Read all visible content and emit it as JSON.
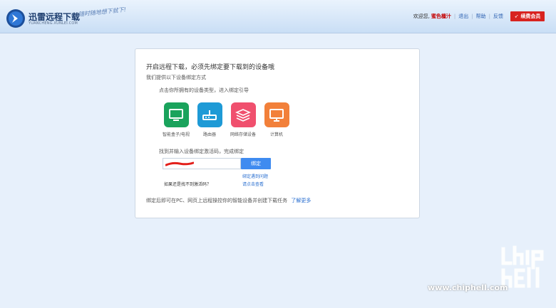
{
  "header": {
    "logo_title": "迅雷远程下载",
    "logo_sub": "YUANCHENG.XUNLEI.COM",
    "slogan": "随时随地想下就下!",
    "welcome": "欢迎您,",
    "username": "蜜色檀汁",
    "logout": "退出",
    "help": "帮助",
    "feedback": "反馈",
    "vip_button": "续费会员"
  },
  "panel": {
    "title": "开启远程下载，必须先绑定要下载到的设备哦",
    "subtitle": "我们提供以下设备绑定方式",
    "step1": "点击你所拥有的设备类型，进入绑定引导",
    "devices": [
      {
        "label": "智能盒子/电视",
        "color": "#1aa35c"
      },
      {
        "label": "路由器",
        "color": "#1e9ad6"
      },
      {
        "label": "网络存储设备",
        "color": "#f0506e"
      },
      {
        "label": "计算机",
        "color": "#f2803a"
      }
    ],
    "step2": "找到并输入设备绑定激活码，完成绑定",
    "bind_button": "绑定",
    "help_link_1": "绑定遇到问题",
    "help_link_2": "请点击查看",
    "no_code_text": "如果还是找不到激活码？",
    "footer_text": "绑定后即可在PC、网页上远程操控你的智能设备并创建下载任务",
    "learn_more": "了解更多"
  },
  "watermark": {
    "site": "www.chiphell.com",
    "logo": "chip hell"
  }
}
